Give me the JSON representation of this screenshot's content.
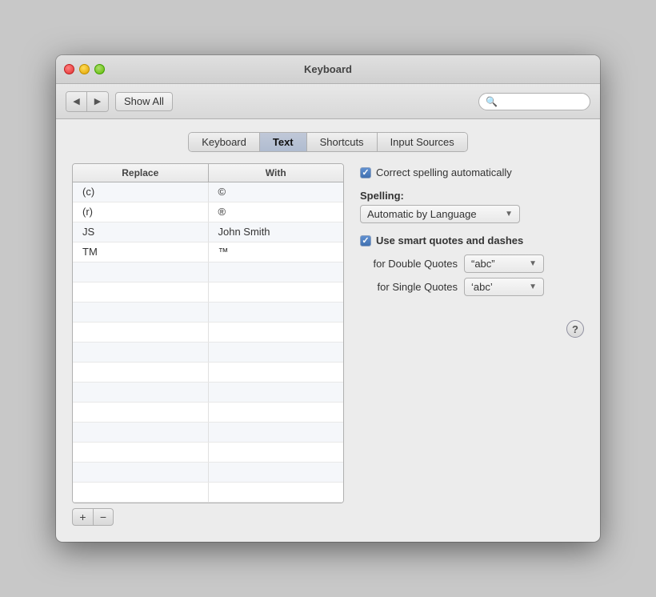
{
  "window": {
    "title": "Keyboard"
  },
  "toolbar": {
    "show_all_label": "Show All",
    "search_placeholder": ""
  },
  "tabs": {
    "items": [
      {
        "id": "keyboard",
        "label": "Keyboard"
      },
      {
        "id": "text",
        "label": "Text",
        "active": true
      },
      {
        "id": "shortcuts",
        "label": "Shortcuts"
      },
      {
        "id": "input-sources",
        "label": "Input Sources"
      }
    ]
  },
  "table": {
    "headers": [
      "Replace",
      "With"
    ],
    "rows": [
      {
        "replace": "(c)",
        "with": "©"
      },
      {
        "replace": "(r)",
        "with": "®"
      },
      {
        "replace": "JS",
        "with": "John Smith"
      },
      {
        "replace": "TM",
        "with": "™"
      }
    ],
    "add_label": "+",
    "remove_label": "−"
  },
  "settings": {
    "correct_spelling_label": "Correct spelling automatically",
    "spelling_section_label": "Spelling:",
    "spelling_value": "Automatic by Language",
    "smart_quotes_label": "Use smart quotes and dashes",
    "double_quotes_label": "for Double Quotes",
    "double_quotes_value": "“abc”",
    "single_quotes_label": "for Single Quotes",
    "single_quotes_value": "‘abc’"
  }
}
